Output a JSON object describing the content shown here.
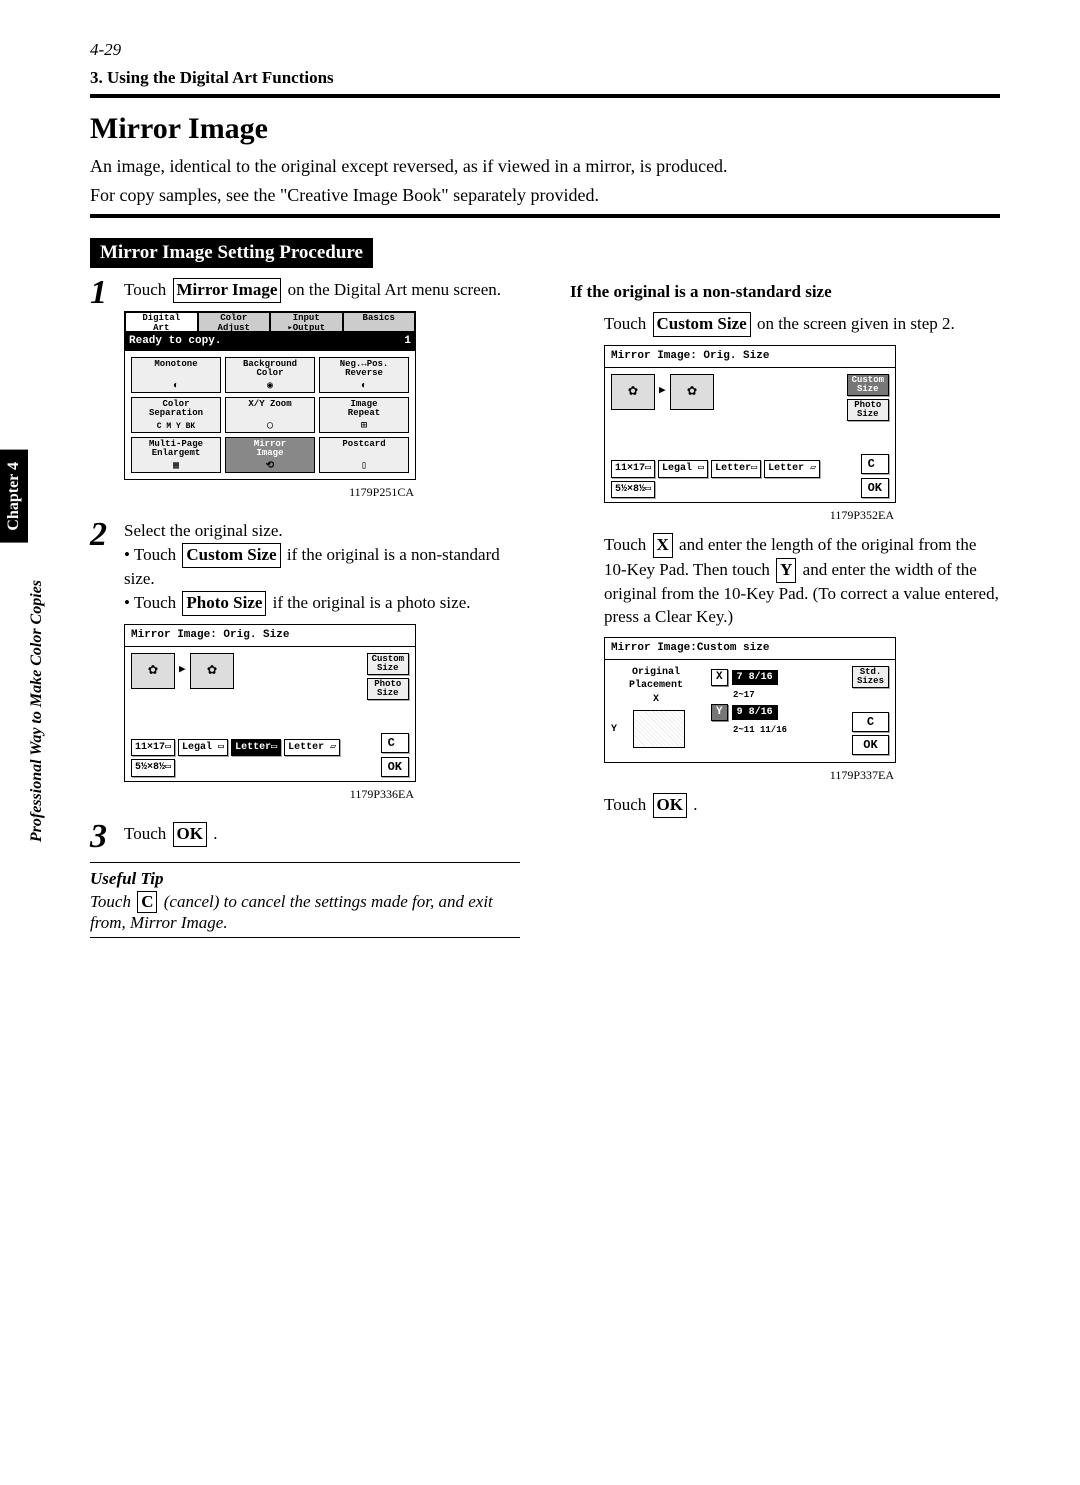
{
  "page_number": "4-29",
  "breadcrumb": "3. Using the Digital Art Functions",
  "title": "Mirror Image",
  "intro_1": "An image, identical to the original except reversed, as if viewed in a mirror, is produced.",
  "intro_2": "For copy samples, see the \"Creative Image Book\" separately provided.",
  "procedure_header": "Mirror Image Setting Procedure",
  "side_tab": "Chapter 4",
  "side_text": "Professional Way to Make Color Copies",
  "left": {
    "step1_pre": "Touch ",
    "step1_btn": "Mirror Image",
    "step1_post": " on the Digital Art menu screen.",
    "fig1_cap": "1179P251CA",
    "step2_intro": "Select the original size.",
    "step2_a_pre": "• Touch ",
    "step2_a_btn": "Custom Size",
    "step2_a_post": " if the original is a non-standard size.",
    "step2_b_pre": "• Touch ",
    "step2_b_btn": "Photo Size",
    "step2_b_post": " if the original is a photo size.",
    "fig2_cap": "1179P336EA",
    "step3_pre": "Touch ",
    "step3_btn": "OK",
    "step3_post": " .",
    "tip_title": "Useful Tip",
    "tip_pre": "Touch ",
    "tip_btn": "C",
    "tip_post": " (cancel) to cancel the settings made for, and exit from, Mirror Image."
  },
  "right": {
    "header": "If the original is a non-standard size",
    "p1_pre": "Touch ",
    "p1_btn": "Custom Size",
    "p1_post": " on the screen given in step 2.",
    "fig3_cap": "1179P352EA",
    "p2_a": "Touch ",
    "p2_x": "X",
    "p2_b": " and enter the length of the original from the 10-Key Pad. Then touch ",
    "p2_y": "Y",
    "p2_c": " and enter the width of the original from the 10-Key Pad. (To correct a value entered, press a Clear Key.)",
    "fig4_cap": "1179P337EA",
    "p3_pre": "Touch ",
    "p3_btn": "OK",
    "p3_post": " ."
  },
  "da_screen": {
    "tabs": [
      "Digital\nArt",
      "Color\nAdjust",
      "Input\n▸Output",
      "Basics"
    ],
    "status": "Ready to copy.",
    "status_num": "1",
    "cells": [
      "Monotone",
      "Background\nColor",
      "Neg.↔Pos.\nReverse",
      "Color\nSeparation",
      "X/Y Zoom",
      "Image\nRepeat",
      "Multi-Page\nEnlargemt",
      "Mirror\nImage",
      "Postcard"
    ]
  },
  "os_screen": {
    "title": "Mirror Image: Orig. Size",
    "right_btns": [
      "Custom\nSize",
      "Photo\nSize"
    ],
    "sizes": [
      "11×17▭",
      "Legal ▭",
      "Letter▭",
      "Letter ▱",
      "5½×8½▭"
    ],
    "c": "C",
    "ok": "OK"
  },
  "cs_screen": {
    "title": "Mirror Image:Custom size",
    "placement": "Original\nPlacement",
    "std": "Std.\nSizes",
    "x_label": "X",
    "x_val": "7 8/16",
    "x_range": "2~17",
    "y_label": "Y",
    "y_val": "9 8/16",
    "y_range": "2~11 11/16",
    "c": "C",
    "ok": "OK"
  }
}
